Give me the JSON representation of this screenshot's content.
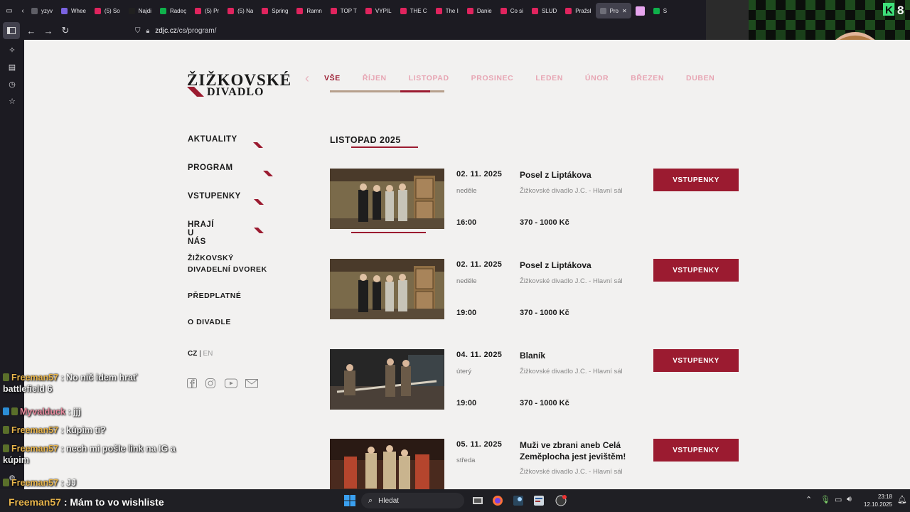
{
  "browser": {
    "tabs": [
      {
        "label": "yzyv",
        "color": "#5e5e66"
      },
      {
        "label": "Whee",
        "color": "#7a63e0"
      },
      {
        "label": "(5) So",
        "color": "#e0245e"
      },
      {
        "label": "Najdi",
        "color": "#202020"
      },
      {
        "label": "Radeç",
        "color": "#0fb14b"
      },
      {
        "label": "(5) Pr",
        "color": "#e0245e"
      },
      {
        "label": "(5) Na",
        "color": "#e0245e"
      },
      {
        "label": "Spring",
        "color": "#e0245e"
      },
      {
        "label": "Ramn",
        "color": "#e0245e"
      },
      {
        "label": "TOP T",
        "color": "#e0245e"
      },
      {
        "label": "VYPIL",
        "color": "#e0245e"
      },
      {
        "label": "THE C",
        "color": "#e0245e"
      },
      {
        "label": "The I",
        "color": "#e0245e"
      },
      {
        "label": "Danie",
        "color": "#e0245e"
      },
      {
        "label": "Co si",
        "color": "#e0245e"
      },
      {
        "label": "SLUD",
        "color": "#e0245e"
      },
      {
        "label": "Pražsl",
        "color": "#e0245e"
      },
      {
        "label": "Pro",
        "color": "#6e6e78",
        "active": true
      }
    ],
    "url_host": "zdjc.cz",
    "url_path": "/cs/program/"
  },
  "webcam": {
    "score": "8"
  },
  "logo": {
    "line1": "ŽIŽKOVSKÉ",
    "line2": "DIVADLO"
  },
  "month_nav": [
    "VŠE",
    "ŘÍJEN",
    "LISTOPAD",
    "PROSINEC",
    "LEDEN",
    "ÚNOR",
    "BŘEZEN",
    "DUBEN"
  ],
  "menu": {
    "main": [
      "AKTUALITY",
      "PROGRAM",
      "VSTUPENKY",
      "HRAJÍ U NÁS"
    ],
    "sub1_line1": "ŽIŽKOVSKÝ",
    "sub1_line2": "DIVADELNÍ DVOREK",
    "sub2": "PŘEDPLATNÉ",
    "sub3": "O DIVADLE",
    "lang_cz": "CZ",
    "lang_sep": "|",
    "lang_en": "EN"
  },
  "section_title": "LISTOPAD 2025",
  "events": [
    {
      "date": "02. 11. 2025",
      "day": "neděle",
      "time": "16:00",
      "title": "Posel z Liptákova",
      "venue": "Žižkovské divadlo J.C. - Hlavní sál",
      "price": "370 - 1000 Kč",
      "button": "VSTUPENKY"
    },
    {
      "date": "02. 11. 2025",
      "day": "neděle",
      "time": "19:00",
      "title": "Posel z Liptákova",
      "venue": "Žižkovské divadlo J.C. - Hlavní sál",
      "price": "370 - 1000 Kč",
      "button": "VSTUPENKY"
    },
    {
      "date": "04. 11. 2025",
      "day": "úterý",
      "time": "19:00",
      "title": "Blaník",
      "venue": "Žižkovské divadlo J.C. - Hlavní sál",
      "price": "370 - 1000 Kč",
      "button": "VSTUPENKY"
    },
    {
      "date": "05. 11. 2025",
      "day": "středa",
      "time": "",
      "title": "Muži ve zbrani aneb Celá Zeměplocha jest jevištěm!",
      "venue": "Žižkovské divadlo J.C. - Hlavní sál",
      "price": "",
      "button": "VSTUPENKY"
    }
  ],
  "chat": [
    {
      "name": "Freeman57",
      "msg": ": No nič idem hrať",
      "cont": "battlefield 6"
    },
    {
      "name": "Myvalduck",
      "msg": ": jjj"
    },
    {
      "name": "Freeman57",
      "msg": ": kúpim ti?"
    },
    {
      "name": "Freeman57",
      "msg": ": nech mi pošle link na IG a",
      "cont": "kúpim"
    },
    {
      "name": "Freeman57",
      "msg": ": JJ"
    }
  ],
  "chat_bottom": {
    "name": "Freeman57",
    "msg": ": Mám to vo wishliste"
  },
  "taskbar": {
    "search_placeholder": "Hledat",
    "time": "23:18",
    "date": "12.10.2025"
  }
}
